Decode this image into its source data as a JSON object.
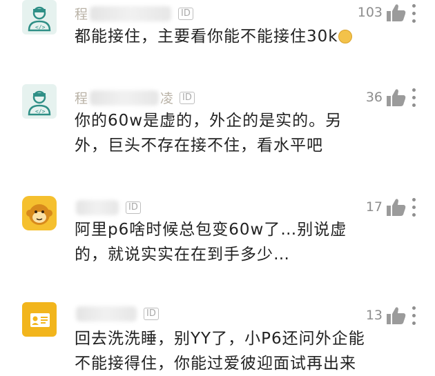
{
  "comments": [
    {
      "username_visible_prefix": "程",
      "username_visible_suffix": "",
      "badge": "ID",
      "likes": "103",
      "lines": [
        "都能接住，主要看你能不能接住30k"
      ],
      "emoji": "grinning-face-emoji",
      "avatar": "programmer-avatar"
    },
    {
      "username_visible_prefix": "程",
      "username_visible_suffix": "凌",
      "badge": "ID",
      "likes": "36",
      "lines": [
        "你的60w是虚的，外企的是实的。另",
        "外，巨头不存在接不住，看水平吧"
      ],
      "avatar": "programmer-avatar"
    },
    {
      "username_visible_prefix": "",
      "username_visible_suffix": "",
      "badge": "ID",
      "likes": "17",
      "lines": [
        "阿里p6啥时候总包变60w了…别说虚",
        "的，就说实实在在到手多少…"
      ],
      "avatar": "monkey-avatar"
    },
    {
      "username_visible_prefix": "",
      "username_visible_suffix": "",
      "badge": "ID",
      "likes": "13",
      "lines": [
        "回去洗洗睡，别YY了，小P6还问外企能",
        "不能接得住，你能过爱彼迎面试再出来"
      ],
      "avatar": "id-card-avatar"
    }
  ],
  "colors": {
    "username": "#b9b2a6",
    "body_text": "#222222",
    "likes": "#8d8d8d",
    "programmer_avatar_bg": "#e6f2ef",
    "monkey_avatar_bg": "#f5c02f",
    "id_card_avatar_bg": "#f2b51c"
  },
  "icons": [
    "thumb-up-icon",
    "more-vertical-icon"
  ]
}
